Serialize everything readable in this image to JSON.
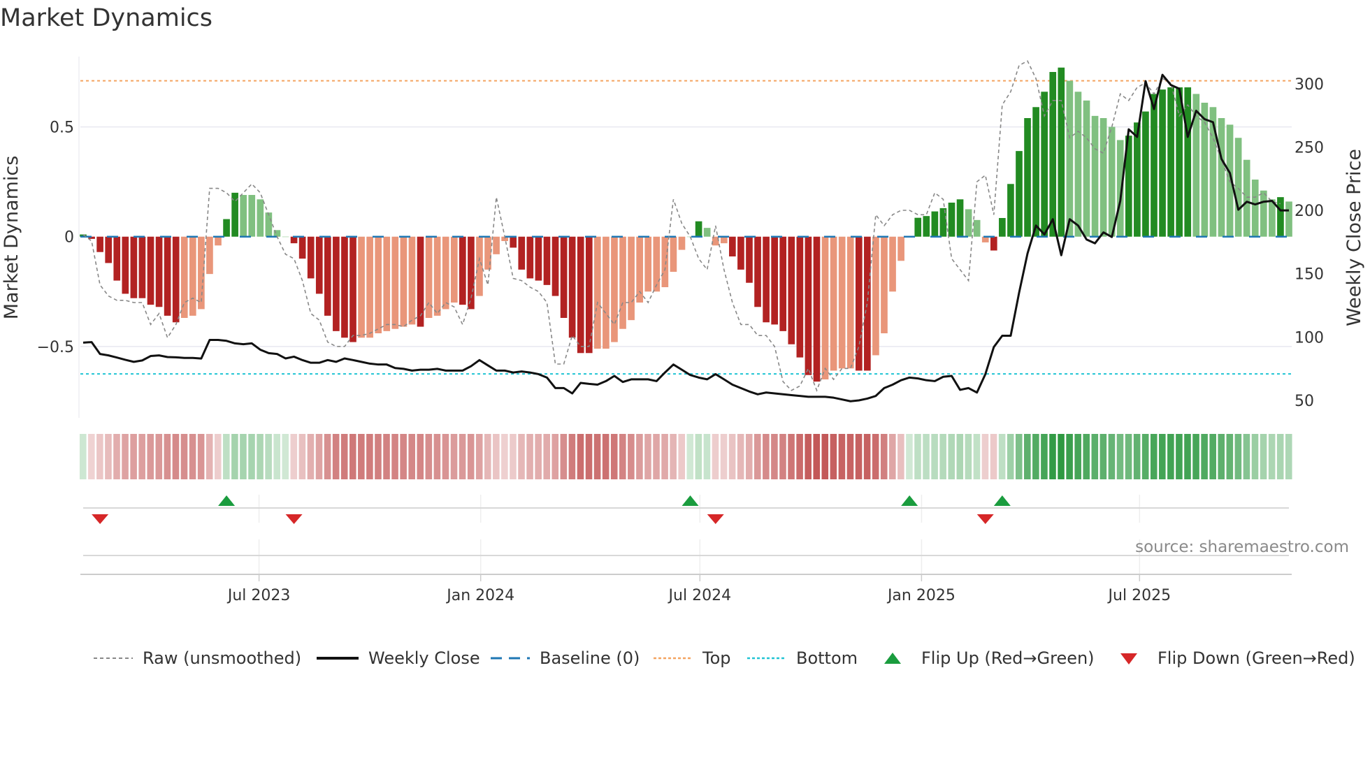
{
  "title": "Market Dynamics",
  "source": "source: sharemaestro.com",
  "legend": {
    "raw": "Raw (unsmoothed)",
    "close": "Weekly Close",
    "baseline": "Baseline (0)",
    "top": "Top",
    "bottom": "Bottom",
    "flip_up": "Flip Up (Red→Green)",
    "flip_down": "Flip Down (Green→Red)"
  },
  "colors": {
    "dark_red": "#b22222",
    "light_red": "#e9967a",
    "dark_green": "#228b22",
    "light_green": "#80c080",
    "top": "#f4a460",
    "bottom": "#22c4d4",
    "baseline": "#1f77b4",
    "flip_up": "#1a9c3e",
    "flip_down": "#d62728"
  },
  "chart_data": {
    "type": "bar",
    "title": "Market Dynamics",
    "ylabel": "Market Dynamics",
    "y2label": "Weekly Close Price",
    "start_week": "2023-02-05",
    "frequency": "weekly",
    "ylim": [
      -0.825,
      0.82
    ],
    "y2lim": [
      36.2,
      321.4
    ],
    "yticks": [
      {
        "v": 0.5,
        "label": "0.5"
      },
      {
        "v": 0,
        "label": "0"
      },
      {
        "v": -0.5,
        "label": "−0.5"
      }
    ],
    "y2ticks": [
      {
        "v": 50,
        "label": "50"
      },
      {
        "v": 100,
        "label": "100"
      },
      {
        "v": 150,
        "label": "150"
      },
      {
        "v": 200,
        "label": "200"
      },
      {
        "v": 250,
        "label": "250"
      },
      {
        "v": 300,
        "label": "300"
      }
    ],
    "xticks": [
      {
        "date": "2023-07-01",
        "label": "Jul 2023"
      },
      {
        "date": "2024-01-01",
        "label": "Jan 2024"
      },
      {
        "date": "2024-07-01",
        "label": "Jul 2024"
      },
      {
        "date": "2025-01-01",
        "label": "Jan 2025"
      },
      {
        "date": "2025-07-01",
        "label": "Jul 2025"
      }
    ],
    "top": 0.71,
    "bottom": -0.625,
    "baseline": 0,
    "dynamics": [
      0.01,
      -0.01,
      -0.07,
      -0.12,
      -0.2,
      -0.26,
      -0.28,
      -0.28,
      -0.31,
      -0.32,
      -0.36,
      -0.39,
      -0.37,
      -0.36,
      -0.33,
      -0.17,
      -0.04,
      0.08,
      0.2,
      0.19,
      0.19,
      0.17,
      0.11,
      0.03,
      0.0,
      -0.03,
      -0.1,
      -0.19,
      -0.26,
      -0.36,
      -0.43,
      -0.46,
      -0.48,
      -0.46,
      -0.46,
      -0.44,
      -0.43,
      -0.42,
      -0.41,
      -0.4,
      -0.41,
      -0.37,
      -0.36,
      -0.33,
      -0.3,
      -0.31,
      -0.33,
      -0.27,
      -0.15,
      -0.08,
      -0.02,
      -0.05,
      -0.15,
      -0.19,
      -0.2,
      -0.22,
      -0.27,
      -0.37,
      -0.46,
      -0.53,
      -0.53,
      -0.51,
      -0.51,
      -0.48,
      -0.42,
      -0.38,
      -0.3,
      -0.25,
      -0.25,
      -0.23,
      -0.16,
      -0.06,
      0.0,
      0.07,
      0.04,
      -0.04,
      -0.03,
      -0.09,
      -0.15,
      -0.21,
      -0.32,
      -0.39,
      -0.4,
      -0.43,
      -0.49,
      -0.55,
      -0.63,
      -0.66,
      -0.65,
      -0.61,
      -0.6,
      -0.6,
      -0.61,
      -0.61,
      -0.54,
      -0.44,
      -0.25,
      -0.11,
      0.0,
      0.086,
      0.094,
      0.115,
      0.13,
      0.155,
      0.17,
      0.125,
      0.076,
      -0.026,
      -0.063,
      0.085,
      0.24,
      0.39,
      0.54,
      0.59,
      0.66,
      0.75,
      0.77,
      0.71,
      0.66,
      0.62,
      0.55,
      0.54,
      0.5,
      0.44,
      0.46,
      0.52,
      0.57,
      0.65,
      0.67,
      0.68,
      0.68,
      0.68,
      0.65,
      0.61,
      0.59,
      0.54,
      0.51,
      0.45,
      0.35,
      0.26,
      0.21,
      0.17,
      0.18,
      0.16
    ],
    "raw": [
      0.01,
      -0.02,
      -0.22,
      -0.27,
      -0.29,
      -0.29,
      -0.3,
      -0.3,
      -0.4,
      -0.35,
      -0.46,
      -0.4,
      -0.3,
      -0.28,
      -0.3,
      0.22,
      0.22,
      0.2,
      0.16,
      0.2,
      0.24,
      0.2,
      0.1,
      0.0,
      -0.08,
      -0.1,
      -0.2,
      -0.35,
      -0.38,
      -0.48,
      -0.5,
      -0.5,
      -0.45,
      -0.45,
      -0.44,
      -0.42,
      -0.4,
      -0.4,
      -0.41,
      -0.38,
      -0.36,
      -0.3,
      -0.35,
      -0.3,
      -0.32,
      -0.4,
      -0.28,
      -0.1,
      -0.22,
      0.18,
      0.0,
      -0.19,
      -0.2,
      -0.23,
      -0.25,
      -0.3,
      -0.58,
      -0.58,
      -0.45,
      -0.5,
      -0.5,
      -0.3,
      -0.35,
      -0.4,
      -0.3,
      -0.3,
      -0.25,
      -0.3,
      -0.22,
      -0.15,
      0.17,
      0.06,
      0.0,
      -0.1,
      -0.15,
      0.05,
      -0.15,
      -0.3,
      -0.4,
      -0.4,
      -0.45,
      -0.45,
      -0.5,
      -0.66,
      -0.7,
      -0.68,
      -0.6,
      -0.7,
      -0.6,
      -0.65,
      -0.6,
      -0.6,
      -0.5,
      -0.3,
      0.1,
      0.05,
      0.1,
      0.12,
      0.12,
      0.1,
      0.1,
      0.2,
      0.17,
      -0.1,
      -0.15,
      -0.2,
      0.25,
      0.28,
      0.1,
      0.6,
      0.66,
      0.78,
      0.8,
      0.72,
      0.55,
      0.62,
      0.62,
      0.45,
      0.48,
      0.45,
      0.4,
      0.38,
      0.5,
      0.65,
      0.62,
      0.68,
      0.7,
      0.65,
      0.72,
      0.7,
      0.55,
      0.6,
      0.55,
      0.52,
      0.45,
      0.35,
      0.25,
      0.22,
      0.18,
      0.18,
      0.2,
      0.16,
      0.15
    ],
    "weekly_close": [
      95.6,
      96,
      86.6,
      85.5,
      83.8,
      82,
      80.4,
      81.5,
      85,
      85.5,
      84.2,
      84,
      83.5,
      83.5,
      83,
      97.7,
      97.7,
      97,
      95,
      94.3,
      95,
      90,
      87.3,
      86.6,
      83.1,
      84.5,
      81.8,
      79.7,
      79.7,
      81.8,
      80.4,
      83.1,
      81.8,
      80.4,
      79,
      78.3,
      78.3,
      75.5,
      74.9,
      73.5,
      74.2,
      74.2,
      74.9,
      73.5,
      73.5,
      73.5,
      77,
      81.8,
      77.6,
      73.5,
      73.5,
      72,
      72.8,
      72,
      70.7,
      68,
      59.7,
      59.7,
      55.5,
      63.8,
      63,
      62.4,
      65.2,
      69.3,
      64.5,
      66.6,
      66.6,
      66.6,
      65.2,
      72,
      78.3,
      74.2,
      70,
      68,
      66.6,
      70.7,
      66.6,
      62.4,
      59.7,
      57,
      54.8,
      56.2,
      55.5,
      54.8,
      54.1,
      53.5,
      52.8,
      52.8,
      52.8,
      52.1,
      50.7,
      49.3,
      50,
      51.4,
      53.5,
      59.7,
      62.4,
      65.9,
      68,
      67.3,
      65.9,
      65.2,
      68.6,
      69.3,
      58.3,
      59.7,
      56.2,
      70.7,
      92.1,
      101,
      101,
      135,
      166,
      188,
      181,
      193,
      164.6,
      193,
      188,
      177,
      174,
      182.6,
      179,
      207.5,
      264,
      258,
      302,
      280,
      307,
      299,
      296,
      258,
      278.6,
      272,
      269.6,
      240.6,
      229.5,
      200.5,
      206.8,
      204.7,
      206.8,
      207.5,
      200,
      200
    ],
    "flip_up_weeks": [
      17,
      72,
      98,
      109
    ],
    "flip_down_weeks": [
      2,
      25,
      75,
      107
    ]
  }
}
